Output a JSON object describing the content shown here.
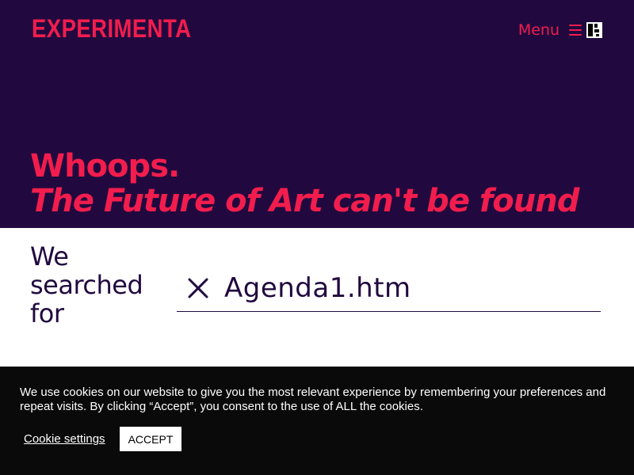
{
  "header": {
    "logo_text": "EXPERIMENTA",
    "menu_label": "Menu",
    "colors": {
      "background": "#21093f",
      "accent": "#f21d4d"
    }
  },
  "hero": {
    "line1": "Whoops.",
    "line2": "The Future of Art can't be found"
  },
  "search": {
    "label_lines": [
      "We",
      "searched",
      "for"
    ],
    "value": "Agenda1.htm"
  },
  "cookie_banner": {
    "text": "We use cookies on our website to give you the most relevant experience by remembering your preferences and repeat visits. By clicking “Accept”, you consent to the use of ALL the cookies.",
    "settings_label": "Cookie settings",
    "accept_label": "ACCEPT"
  },
  "icons": [
    "menu-icon",
    "brand-square-icon",
    "close-icon"
  ]
}
